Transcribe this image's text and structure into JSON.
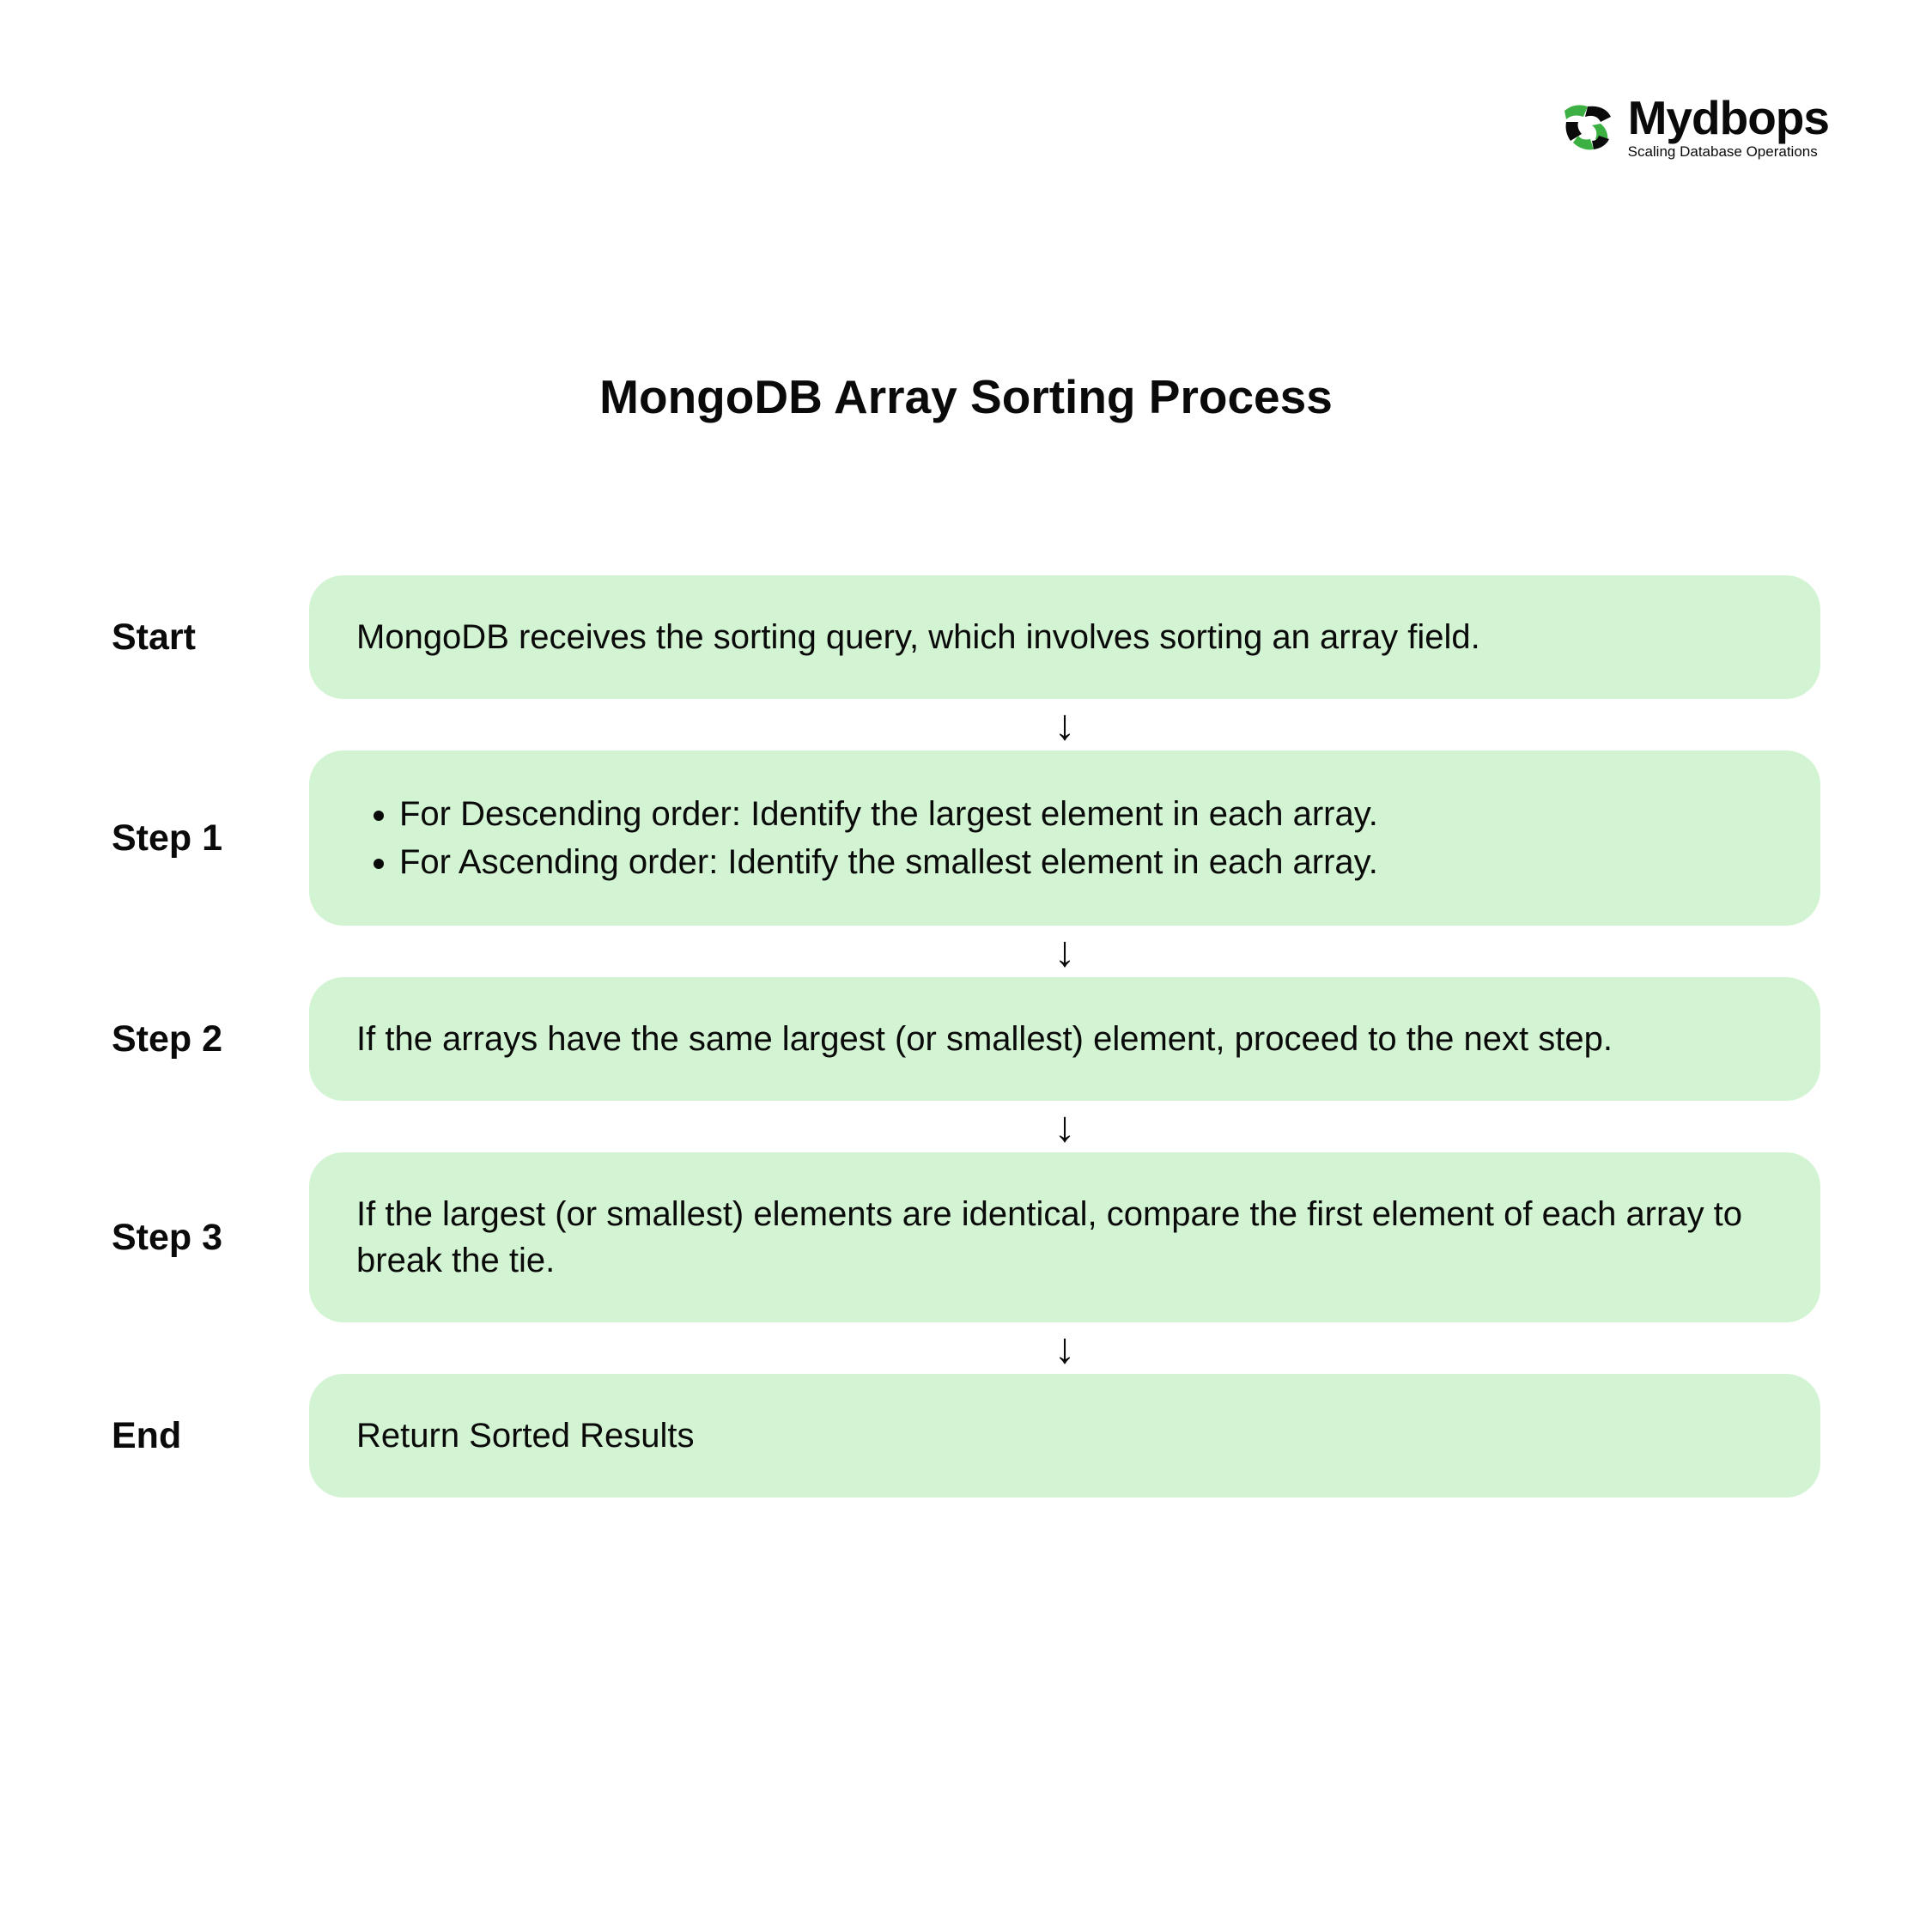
{
  "logo": {
    "name": "Mydbops",
    "tagline": "Scaling Database Operations"
  },
  "title": "MongoDB Array Sorting Process",
  "steps": [
    {
      "label": "Start",
      "type": "text",
      "content": "MongoDB receives the sorting query, which involves sorting an array field."
    },
    {
      "label": "Step 1",
      "type": "list",
      "items": [
        "For Descending order: Identify the largest element in each array.",
        "For Ascending order: Identify the smallest element in each array."
      ]
    },
    {
      "label": "Step 2",
      "type": "text",
      "content": "If the arrays have the same largest (or smallest) element, proceed to the next step."
    },
    {
      "label": "Step 3",
      "type": "text",
      "content": "If the largest (or smallest) elements are identical, compare the first element of each array to break the tie."
    },
    {
      "label": "End",
      "type": "text",
      "content": "Return Sorted Results"
    }
  ],
  "colors": {
    "card_bg": "#d2f4d2",
    "logo_green": "#3cb043",
    "text": "#0a0a0a"
  }
}
